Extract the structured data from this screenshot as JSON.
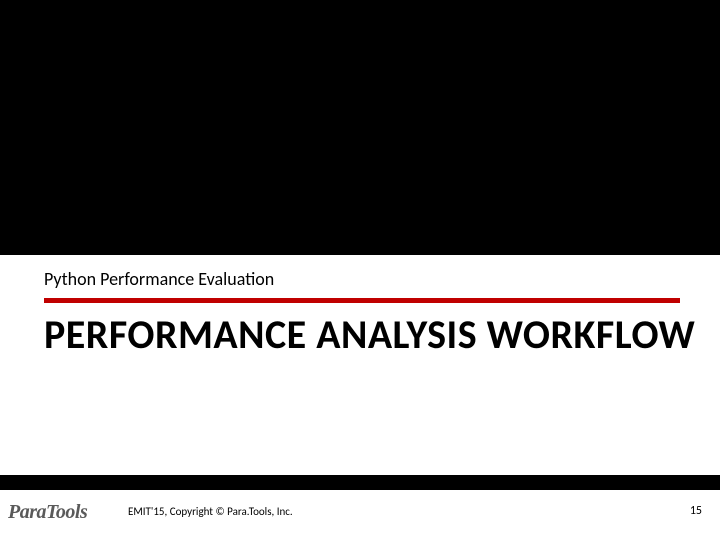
{
  "slide": {
    "subtitle": "Python Performance Evaluation",
    "title": "PERFORMANCE ANALYSIS WORKFLOW"
  },
  "footer": {
    "logo_text": "ParaTools",
    "copyright": "EMIT'15, Copyright © Para.Tools, Inc.",
    "page_number": "15"
  },
  "colors": {
    "accent": "#c00000",
    "background": "#000000",
    "band": "#ffffff"
  }
}
